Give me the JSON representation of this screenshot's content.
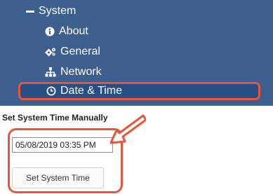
{
  "nav": {
    "items": [
      {
        "label": "System",
        "icon": "minus-icon"
      },
      {
        "label": "About",
        "icon": "info-circle-icon"
      },
      {
        "label": "General",
        "icon": "cogs-icon"
      },
      {
        "label": "Network",
        "icon": "sitemap-icon"
      },
      {
        "label": "Date & Time",
        "icon": "clock-icon",
        "selected": true
      }
    ]
  },
  "main": {
    "section_title": "Set System Time Manually",
    "datetime_value": "05/08/2019 03:35 PM",
    "set_button_label": "Set System Time"
  },
  "colors": {
    "nav_bg": "#3d5f8f",
    "nav_selected_bg": "#274e85",
    "highlight": "#e8553a"
  }
}
